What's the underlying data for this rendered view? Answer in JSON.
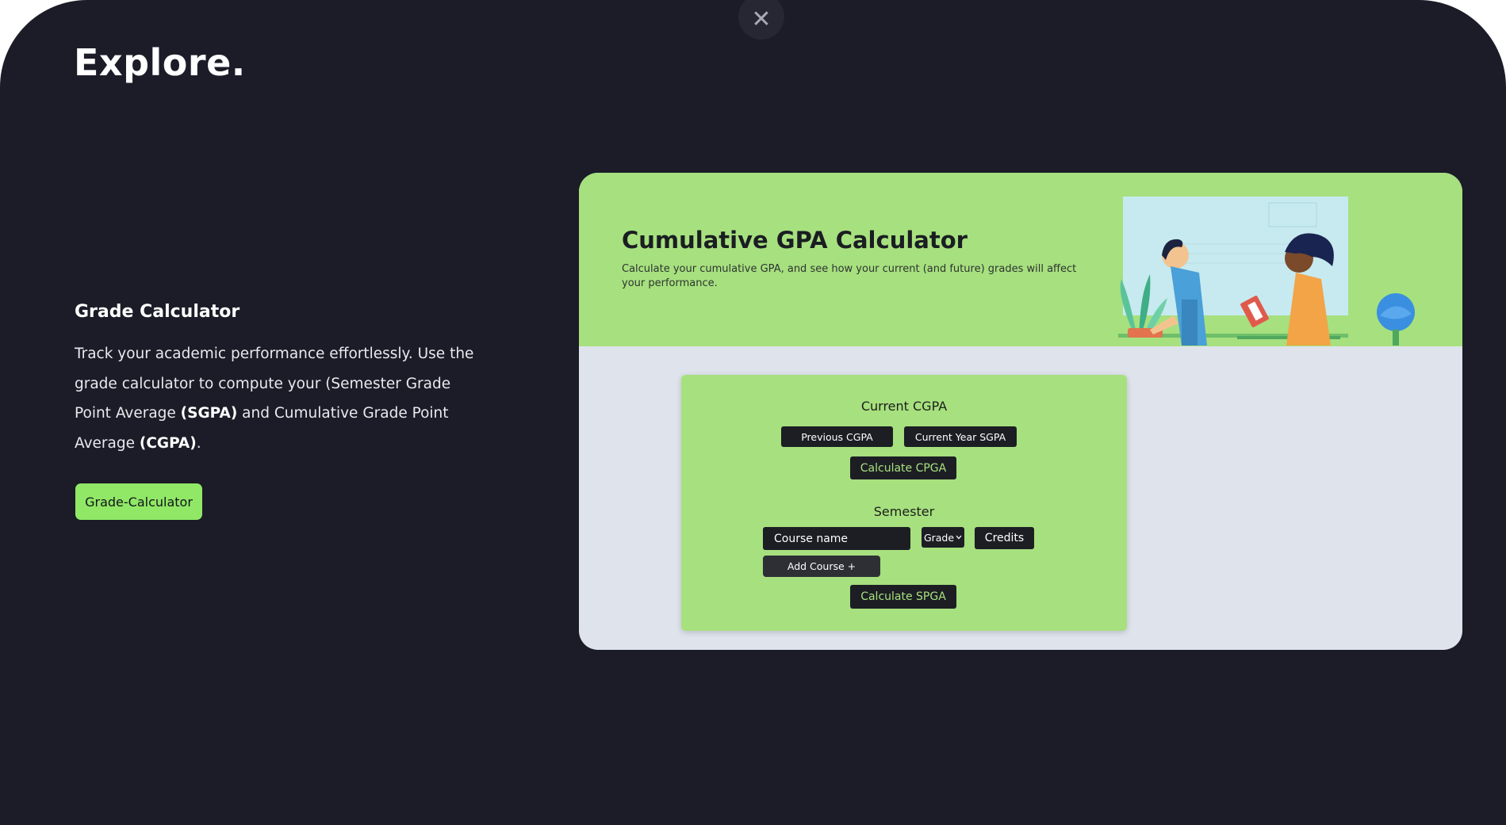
{
  "modal": {
    "close_glyph": "✕",
    "title": "Explore.",
    "card": {
      "title": "Grade Calculator",
      "description_parts": [
        "Track your academic performance effortlessly. Use the grade calculator to compute your (Semester Grade Point Average ",
        "(SGPA)",
        " and Cumulative Grade Point Average ",
        "(CGPA)",
        "."
      ],
      "button_label": "Grade-Calculator"
    }
  },
  "preview": {
    "banner": {
      "title": "Cumulative GPA Calculator",
      "subtitle": "Calculate your cumulative GPA, and see how your current (and future) grades will affect your performance."
    },
    "cgpa_section": {
      "heading": "Current CGPA",
      "previous_cgpa_placeholder": "Previous CGPA",
      "current_year_sgpa_placeholder": "Current Year SGPA",
      "calculate_label": "Calculate CPGA"
    },
    "semester_section": {
      "heading": "Semester",
      "course_name_placeholder": "Course name",
      "grade_select_value": "Grade",
      "credits_placeholder": "Credits",
      "add_course_label": "Add Course +",
      "calculate_label": "Calculate SPGA"
    }
  },
  "colors": {
    "modal_bg": "#1b1c27",
    "accent_green": "#90e866",
    "banner_green": "#a7e07e",
    "preview_bg": "#dfe4ec",
    "dark_field": "#1c1e24"
  },
  "icons": [
    "close-icon",
    "students-illustration",
    "grade-dropdown-chevron-icon"
  ]
}
